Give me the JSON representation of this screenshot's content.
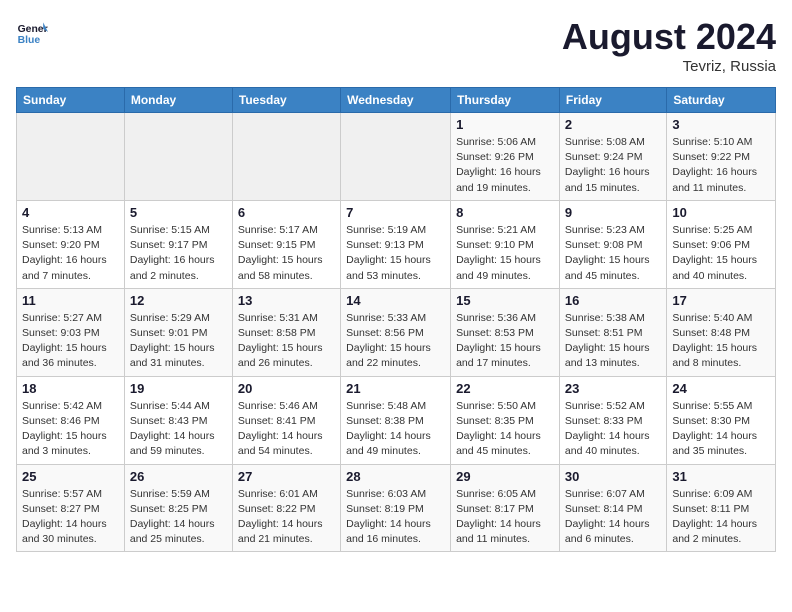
{
  "header": {
    "logo_line1": "General",
    "logo_line2": "Blue",
    "month_year": "August 2024",
    "location": "Tevriz, Russia"
  },
  "weekdays": [
    "Sunday",
    "Monday",
    "Tuesday",
    "Wednesday",
    "Thursday",
    "Friday",
    "Saturday"
  ],
  "weeks": [
    [
      {
        "day": "",
        "info": ""
      },
      {
        "day": "",
        "info": ""
      },
      {
        "day": "",
        "info": ""
      },
      {
        "day": "",
        "info": ""
      },
      {
        "day": "1",
        "info": "Sunrise: 5:06 AM\nSunset: 9:26 PM\nDaylight: 16 hours\nand 19 minutes."
      },
      {
        "day": "2",
        "info": "Sunrise: 5:08 AM\nSunset: 9:24 PM\nDaylight: 16 hours\nand 15 minutes."
      },
      {
        "day": "3",
        "info": "Sunrise: 5:10 AM\nSunset: 9:22 PM\nDaylight: 16 hours\nand 11 minutes."
      }
    ],
    [
      {
        "day": "4",
        "info": "Sunrise: 5:13 AM\nSunset: 9:20 PM\nDaylight: 16 hours\nand 7 minutes."
      },
      {
        "day": "5",
        "info": "Sunrise: 5:15 AM\nSunset: 9:17 PM\nDaylight: 16 hours\nand 2 minutes."
      },
      {
        "day": "6",
        "info": "Sunrise: 5:17 AM\nSunset: 9:15 PM\nDaylight: 15 hours\nand 58 minutes."
      },
      {
        "day": "7",
        "info": "Sunrise: 5:19 AM\nSunset: 9:13 PM\nDaylight: 15 hours\nand 53 minutes."
      },
      {
        "day": "8",
        "info": "Sunrise: 5:21 AM\nSunset: 9:10 PM\nDaylight: 15 hours\nand 49 minutes."
      },
      {
        "day": "9",
        "info": "Sunrise: 5:23 AM\nSunset: 9:08 PM\nDaylight: 15 hours\nand 45 minutes."
      },
      {
        "day": "10",
        "info": "Sunrise: 5:25 AM\nSunset: 9:06 PM\nDaylight: 15 hours\nand 40 minutes."
      }
    ],
    [
      {
        "day": "11",
        "info": "Sunrise: 5:27 AM\nSunset: 9:03 PM\nDaylight: 15 hours\nand 36 minutes."
      },
      {
        "day": "12",
        "info": "Sunrise: 5:29 AM\nSunset: 9:01 PM\nDaylight: 15 hours\nand 31 minutes."
      },
      {
        "day": "13",
        "info": "Sunrise: 5:31 AM\nSunset: 8:58 PM\nDaylight: 15 hours\nand 26 minutes."
      },
      {
        "day": "14",
        "info": "Sunrise: 5:33 AM\nSunset: 8:56 PM\nDaylight: 15 hours\nand 22 minutes."
      },
      {
        "day": "15",
        "info": "Sunrise: 5:36 AM\nSunset: 8:53 PM\nDaylight: 15 hours\nand 17 minutes."
      },
      {
        "day": "16",
        "info": "Sunrise: 5:38 AM\nSunset: 8:51 PM\nDaylight: 15 hours\nand 13 minutes."
      },
      {
        "day": "17",
        "info": "Sunrise: 5:40 AM\nSunset: 8:48 PM\nDaylight: 15 hours\nand 8 minutes."
      }
    ],
    [
      {
        "day": "18",
        "info": "Sunrise: 5:42 AM\nSunset: 8:46 PM\nDaylight: 15 hours\nand 3 minutes."
      },
      {
        "day": "19",
        "info": "Sunrise: 5:44 AM\nSunset: 8:43 PM\nDaylight: 14 hours\nand 59 minutes."
      },
      {
        "day": "20",
        "info": "Sunrise: 5:46 AM\nSunset: 8:41 PM\nDaylight: 14 hours\nand 54 minutes."
      },
      {
        "day": "21",
        "info": "Sunrise: 5:48 AM\nSunset: 8:38 PM\nDaylight: 14 hours\nand 49 minutes."
      },
      {
        "day": "22",
        "info": "Sunrise: 5:50 AM\nSunset: 8:35 PM\nDaylight: 14 hours\nand 45 minutes."
      },
      {
        "day": "23",
        "info": "Sunrise: 5:52 AM\nSunset: 8:33 PM\nDaylight: 14 hours\nand 40 minutes."
      },
      {
        "day": "24",
        "info": "Sunrise: 5:55 AM\nSunset: 8:30 PM\nDaylight: 14 hours\nand 35 minutes."
      }
    ],
    [
      {
        "day": "25",
        "info": "Sunrise: 5:57 AM\nSunset: 8:27 PM\nDaylight: 14 hours\nand 30 minutes."
      },
      {
        "day": "26",
        "info": "Sunrise: 5:59 AM\nSunset: 8:25 PM\nDaylight: 14 hours\nand 25 minutes."
      },
      {
        "day": "27",
        "info": "Sunrise: 6:01 AM\nSunset: 8:22 PM\nDaylight: 14 hours\nand 21 minutes."
      },
      {
        "day": "28",
        "info": "Sunrise: 6:03 AM\nSunset: 8:19 PM\nDaylight: 14 hours\nand 16 minutes."
      },
      {
        "day": "29",
        "info": "Sunrise: 6:05 AM\nSunset: 8:17 PM\nDaylight: 14 hours\nand 11 minutes."
      },
      {
        "day": "30",
        "info": "Sunrise: 6:07 AM\nSunset: 8:14 PM\nDaylight: 14 hours\nand 6 minutes."
      },
      {
        "day": "31",
        "info": "Sunrise: 6:09 AM\nSunset: 8:11 PM\nDaylight: 14 hours\nand 2 minutes."
      }
    ]
  ]
}
